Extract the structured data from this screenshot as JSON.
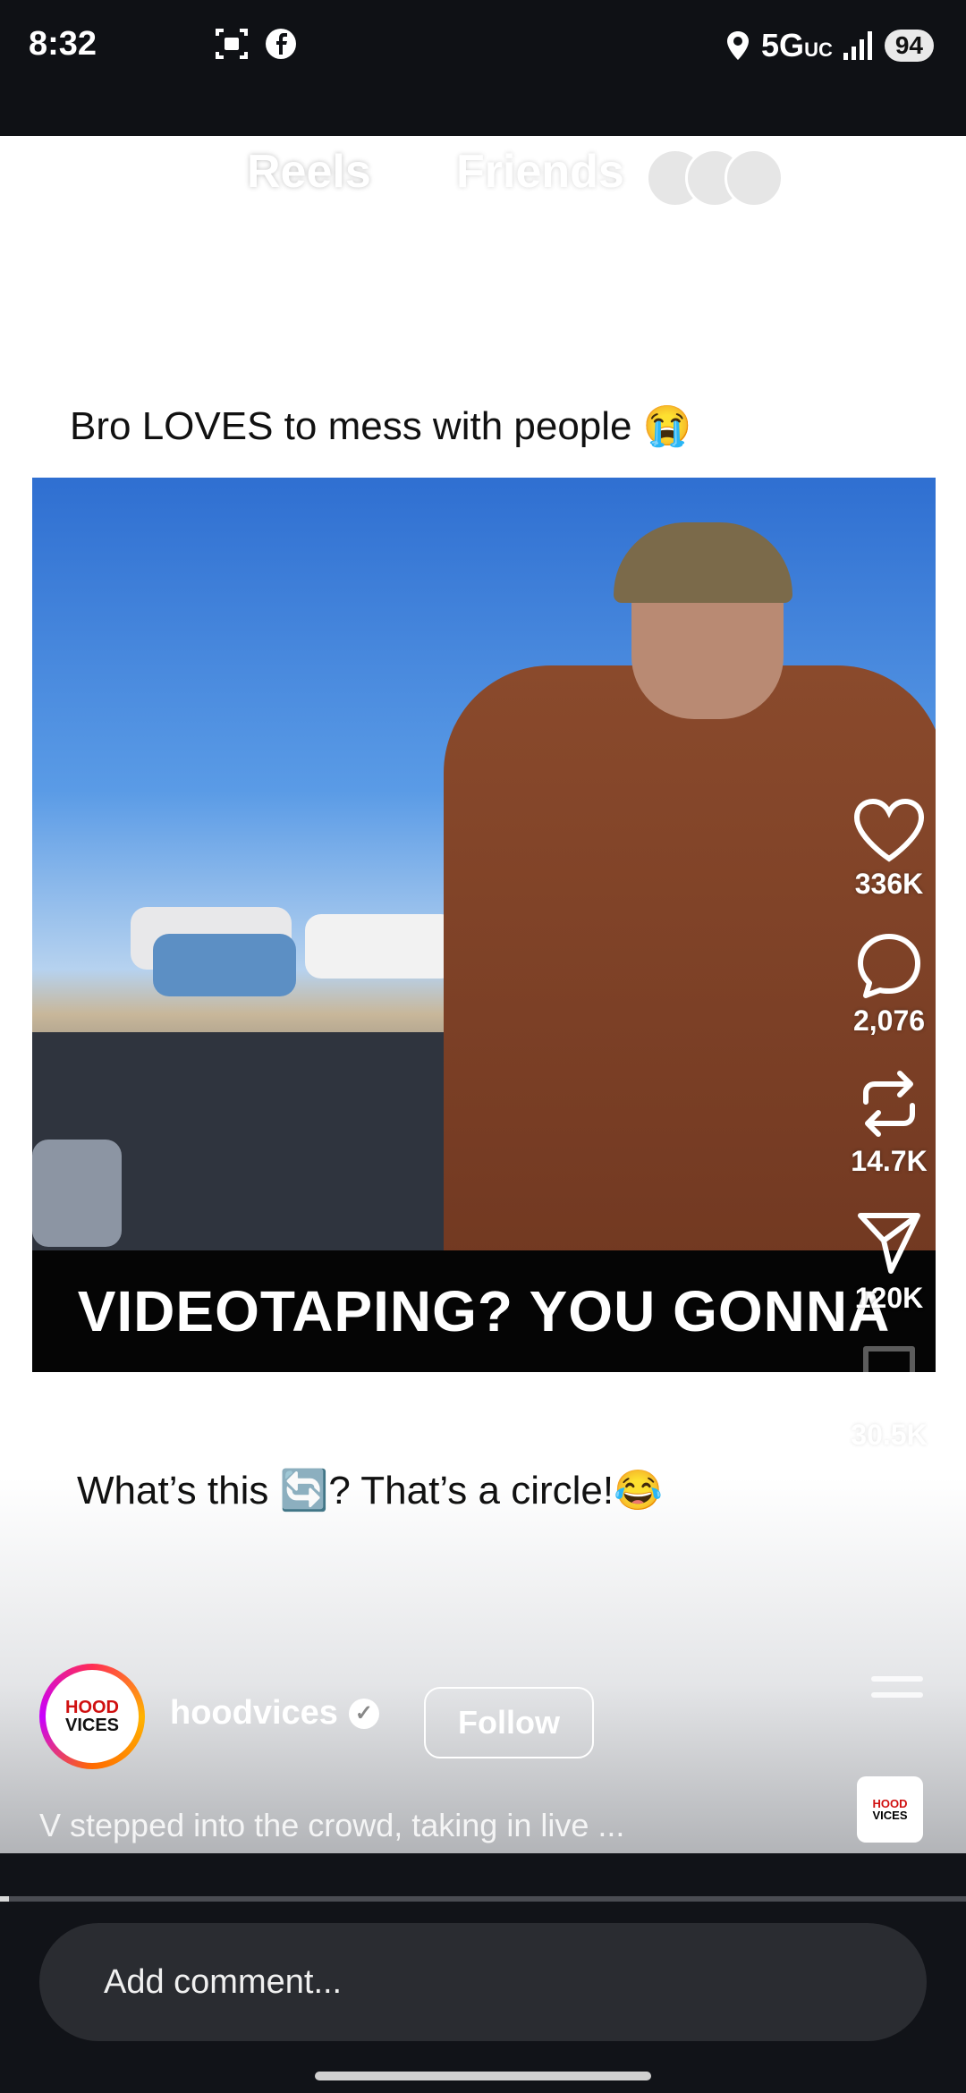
{
  "status_bar": {
    "time": "8:32",
    "network": "5G",
    "network_sub": "UC",
    "battery": "94",
    "left_icons": [
      "screen-record-icon",
      "facebook-icon"
    ],
    "right_icons": [
      "location-icon",
      "signal-icon"
    ]
  },
  "nav": {
    "tabs": [
      "Reels",
      "Friends"
    ],
    "active_tab": "Reels"
  },
  "post": {
    "caption_top": "Bro LOVES to mess with people 😭",
    "subtitle": "VIDEOTAPING? YOU GONNA",
    "caption_bottom": "What’s this 🔄? That’s a circle!😂"
  },
  "actions": {
    "likes": "336K",
    "comments": "2,076",
    "reposts": "14.7K",
    "shares": "120K",
    "saves": "30.5K"
  },
  "author": {
    "avatar_text_line1": "HOOD",
    "avatar_text_line2": "VICES",
    "username": "hoodvices",
    "follow_label": "Follow",
    "description": "V stepped into the crowd, taking in live ..."
  },
  "audio_thumb": {
    "line1": "HOOD",
    "line2": "VICES"
  },
  "comment": {
    "placeholder": "Add comment..."
  },
  "colors": {
    "accent_white": "#ffffff",
    "dark_bg": "#111318",
    "comment_bg": "#2a2c31"
  }
}
